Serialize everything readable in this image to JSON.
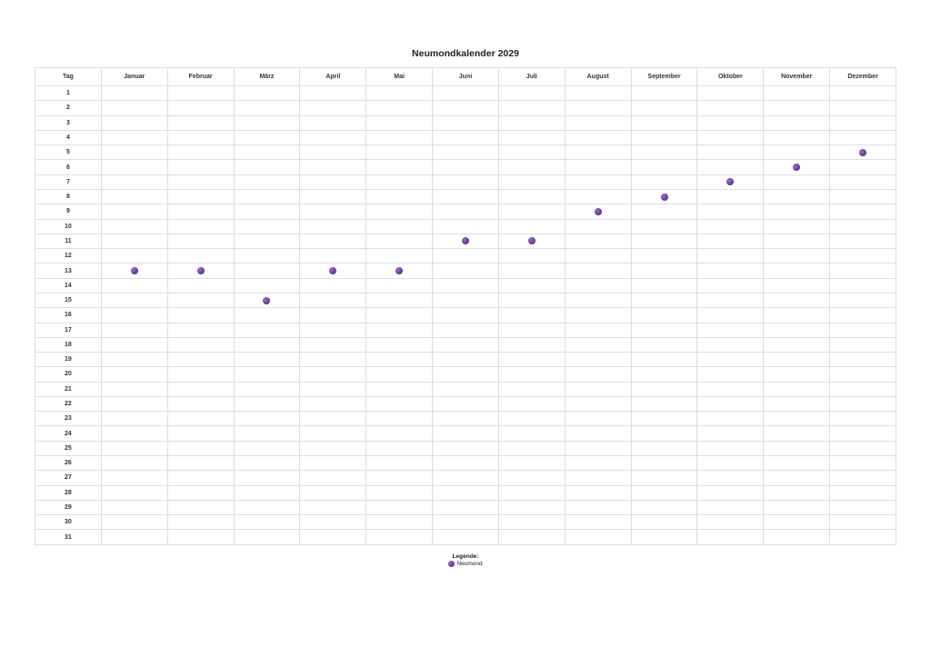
{
  "title": "Neumondkalender 2029",
  "header": {
    "day_label": "Tag",
    "months": [
      "Januar",
      "Februar",
      "März",
      "April",
      "Mai",
      "Juni",
      "Juli",
      "August",
      "September",
      "Oktober",
      "November",
      "Dezember"
    ]
  },
  "days": [
    "1",
    "2",
    "3",
    "4",
    "5",
    "6",
    "7",
    "8",
    "9",
    "10",
    "11",
    "12",
    "13",
    "14",
    "15",
    "16",
    "17",
    "18",
    "19",
    "20",
    "21",
    "22",
    "23",
    "24",
    "25",
    "26",
    "27",
    "28",
    "29",
    "30",
    "31"
  ],
  "new_moons": [
    {
      "month": "Januar",
      "day": 13
    },
    {
      "month": "Februar",
      "day": 13
    },
    {
      "month": "März",
      "day": 15
    },
    {
      "month": "April",
      "day": 13
    },
    {
      "month": "Mai",
      "day": 13
    },
    {
      "month": "Juni",
      "day": 11
    },
    {
      "month": "Juli",
      "day": 11
    },
    {
      "month": "August",
      "day": 9
    },
    {
      "month": "September",
      "day": 8
    },
    {
      "month": "Oktober",
      "day": 7
    },
    {
      "month": "November",
      "day": 6
    },
    {
      "month": "Dezember",
      "day": 5
    }
  ],
  "legend": {
    "title": "Legende:",
    "item_label": "Neumond",
    "icon": "moon-dot-icon",
    "color": "#6a3d9a"
  }
}
